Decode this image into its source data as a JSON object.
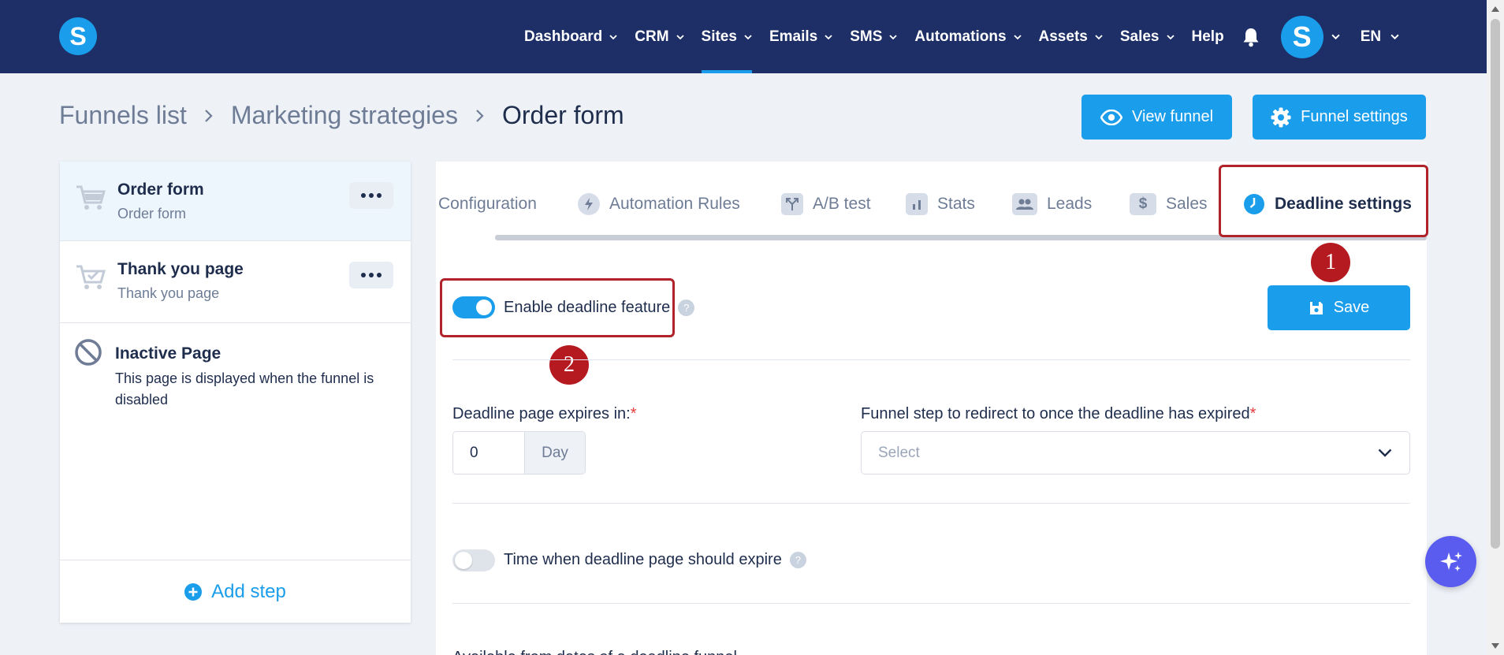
{
  "nav": {
    "logo": "S",
    "items": [
      {
        "label": "Dashboard",
        "dropdown": true,
        "active": false
      },
      {
        "label": "CRM",
        "dropdown": true,
        "active": false
      },
      {
        "label": "Sites",
        "dropdown": true,
        "active": true
      },
      {
        "label": "Emails",
        "dropdown": true,
        "active": false
      },
      {
        "label": "SMS",
        "dropdown": true,
        "active": false
      },
      {
        "label": "Automations",
        "dropdown": true,
        "active": false
      },
      {
        "label": "Assets",
        "dropdown": true,
        "active": false
      },
      {
        "label": "Sales",
        "dropdown": true,
        "active": false
      },
      {
        "label": "Help",
        "dropdown": false,
        "active": false
      }
    ],
    "avatar": "S",
    "language": "EN"
  },
  "breadcrumb": {
    "items": [
      "Funnels list",
      "Marketing strategies"
    ],
    "current": "Order form"
  },
  "header_buttons": {
    "view_funnel": "View funnel",
    "funnel_settings": "Funnel settings"
  },
  "steps": [
    {
      "title": "Order form",
      "subtitle": "Order form"
    },
    {
      "title": "Thank you page",
      "subtitle": "Thank you page"
    }
  ],
  "inactive_page": {
    "title": "Inactive Page",
    "description": "This page is displayed when the funnel is disabled"
  },
  "add_step": "Add step",
  "tabs": [
    {
      "label": "Configuration",
      "icon": "none"
    },
    {
      "label": "Automation Rules",
      "icon": "bolt-icon"
    },
    {
      "label": "A/B test",
      "icon": "split-icon"
    },
    {
      "label": "Stats",
      "icon": "bar-chart-icon"
    },
    {
      "label": "Leads",
      "icon": "users-icon"
    },
    {
      "label": "Sales",
      "icon": "dollar-icon"
    },
    {
      "label": "Deadline settings",
      "icon": "clock-icon",
      "active": true
    }
  ],
  "markers": [
    "1",
    "2"
  ],
  "save_label": "Save",
  "deadline": {
    "enable_label": "Enable deadline feature",
    "enabled": true,
    "expires_label": "Deadline page expires in:",
    "expires_value": "0",
    "expires_unit": "Day",
    "redirect_label": "Funnel step to redirect to once the deadline has expired",
    "redirect_placeholder": "Select",
    "time_label": "Time when deadline page should expire",
    "time_enabled": false,
    "cut_text": "Available from dates of a deadline funnel"
  },
  "help_glyph": "?",
  "required_mark": "*",
  "colors": {
    "nav_bg": "#1d2f66",
    "accent": "#1a9dea",
    "highlight": "#b0232a",
    "marker": "#b41a20"
  }
}
